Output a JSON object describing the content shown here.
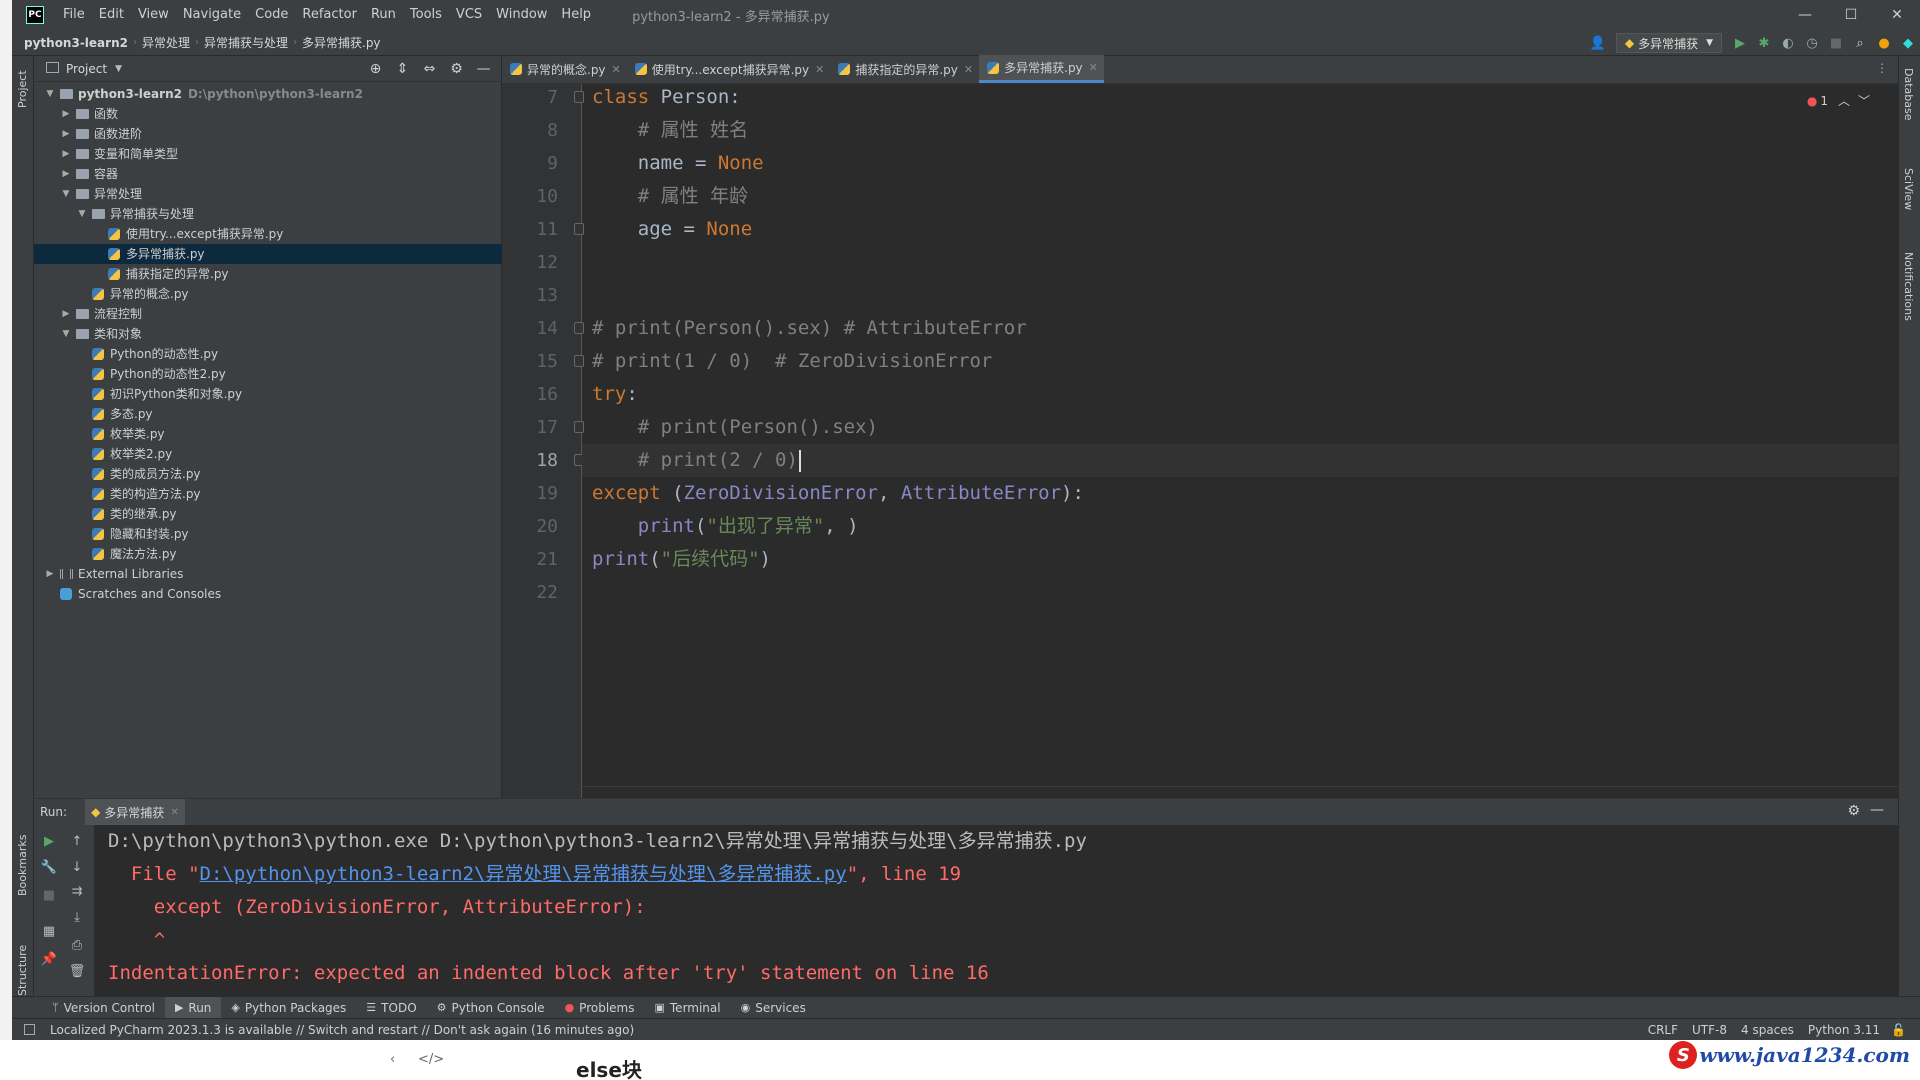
{
  "app": {
    "logo": "PC",
    "title": "python3-learn2 - 多异常捕获.py",
    "menu": [
      "File",
      "Edit",
      "View",
      "Navigate",
      "Code",
      "Refactor",
      "Run",
      "Tools",
      "VCS",
      "Window",
      "Help"
    ]
  },
  "navbar": {
    "crumbs": [
      "python3-learn2",
      "异常处理",
      "异常捕获与处理",
      "多异常捕获.py"
    ],
    "run_config": "多异常捕获"
  },
  "left_strip": {
    "project": "Project",
    "bookmarks": "Bookmarks",
    "structure": "Structure"
  },
  "right_strip": {
    "database": "Database",
    "sciview": "SciView",
    "notifications": "Notifications"
  },
  "project_panel": {
    "title": "Project",
    "tree": [
      {
        "label": "python3-learn2",
        "path": "D:\\python\\python3-learn2",
        "type": "folder",
        "depth": 0,
        "expanded": true,
        "bold": true
      },
      {
        "label": "函数",
        "type": "folder",
        "depth": 1,
        "expanded": false
      },
      {
        "label": "函数进阶",
        "type": "folder",
        "depth": 1,
        "expanded": false
      },
      {
        "label": "变量和简单类型",
        "type": "folder",
        "depth": 1,
        "expanded": false
      },
      {
        "label": "容器",
        "type": "folder",
        "depth": 1,
        "expanded": false
      },
      {
        "label": "异常处理",
        "type": "folder",
        "depth": 1,
        "expanded": true
      },
      {
        "label": "异常捕获与处理",
        "type": "folder",
        "depth": 2,
        "expanded": true
      },
      {
        "label": "使用try...except捕获异常.py",
        "type": "py",
        "depth": 3
      },
      {
        "label": "多异常捕获.py",
        "type": "py",
        "depth": 3,
        "selected": true
      },
      {
        "label": "捕获指定的异常.py",
        "type": "py",
        "depth": 3
      },
      {
        "label": "异常的概念.py",
        "type": "py",
        "depth": 2
      },
      {
        "label": "流程控制",
        "type": "folder",
        "depth": 1,
        "expanded": false
      },
      {
        "label": "类和对象",
        "type": "folder",
        "depth": 1,
        "expanded": true
      },
      {
        "label": "Python的动态性.py",
        "type": "py",
        "depth": 2
      },
      {
        "label": "Python的动态性2.py",
        "type": "py",
        "depth": 2
      },
      {
        "label": "初识Python类和对象.py",
        "type": "py",
        "depth": 2
      },
      {
        "label": "多态.py",
        "type": "py",
        "depth": 2
      },
      {
        "label": "枚举类.py",
        "type": "py",
        "depth": 2
      },
      {
        "label": "枚举类2.py",
        "type": "py",
        "depth": 2
      },
      {
        "label": "类的成员方法.py",
        "type": "py",
        "depth": 2
      },
      {
        "label": "类的构造方法.py",
        "type": "py",
        "depth": 2
      },
      {
        "label": "类的继承.py",
        "type": "py",
        "depth": 2
      },
      {
        "label": "隐藏和封装.py",
        "type": "py",
        "depth": 2
      },
      {
        "label": "魔法方法.py",
        "type": "py",
        "depth": 2
      },
      {
        "label": "External Libraries",
        "type": "lib",
        "depth": 0,
        "expanded": false
      },
      {
        "label": "Scratches and Consoles",
        "type": "scratch",
        "depth": 0
      }
    ]
  },
  "editor": {
    "tabs": [
      {
        "label": "异常的概念.py",
        "active": false
      },
      {
        "label": "使用try...except捕获异常.py",
        "active": false
      },
      {
        "label": "捕获指定的异常.py",
        "active": false
      },
      {
        "label": "多异常捕获.py",
        "active": true
      }
    ],
    "error_count": "1",
    "current_line": 18,
    "lines": [
      {
        "n": 7,
        "tokens": [
          [
            "kw",
            "class "
          ],
          [
            "plain",
            "Person:"
          ]
        ]
      },
      {
        "n": 8,
        "tokens": [
          [
            "cm",
            "    # 属性 姓名"
          ]
        ]
      },
      {
        "n": 9,
        "tokens": [
          [
            "plain",
            "    name = "
          ],
          [
            "kw",
            "None"
          ]
        ]
      },
      {
        "n": 10,
        "tokens": [
          [
            "cm",
            "    # 属性 年龄"
          ]
        ]
      },
      {
        "n": 11,
        "tokens": [
          [
            "plain",
            "    age = "
          ],
          [
            "kw",
            "None"
          ]
        ]
      },
      {
        "n": 12,
        "tokens": []
      },
      {
        "n": 13,
        "tokens": []
      },
      {
        "n": 14,
        "tokens": [
          [
            "cm",
            "# print(Person().sex) # AttributeError"
          ]
        ]
      },
      {
        "n": 15,
        "tokens": [
          [
            "cm",
            "# print(1 / 0)  # ZeroDivisionError"
          ]
        ]
      },
      {
        "n": 16,
        "tokens": [
          [
            "kw",
            "try"
          ],
          [
            "plain",
            ":"
          ]
        ]
      },
      {
        "n": 17,
        "tokens": [
          [
            "cm",
            "    # print(Person().sex)"
          ]
        ]
      },
      {
        "n": 18,
        "tokens": [
          [
            "cm",
            "    # print(2 / 0)"
          ]
        ]
      },
      {
        "n": 19,
        "tokens": [
          [
            "kw",
            "except "
          ],
          [
            "plain",
            "("
          ],
          [
            "builtin",
            "ZeroDivisionError"
          ],
          [
            "plain",
            ", "
          ],
          [
            "builtin",
            "AttributeError"
          ],
          [
            "plain",
            "):"
          ]
        ]
      },
      {
        "n": 20,
        "tokens": [
          [
            "builtin",
            "    print"
          ],
          [
            "plain",
            "("
          ],
          [
            "str",
            "\"出现了异常\""
          ],
          [
            "plain",
            ", )"
          ]
        ]
      },
      {
        "n": 21,
        "tokens": [
          [
            "builtin",
            "print"
          ],
          [
            "plain",
            "("
          ],
          [
            "str",
            "\"后续代码\""
          ],
          [
            "plain",
            ")"
          ]
        ]
      },
      {
        "n": 22,
        "tokens": []
      }
    ]
  },
  "run_panel": {
    "label": "Run:",
    "tab": "多异常捕获",
    "console": [
      {
        "parts": [
          [
            "plain",
            "D:\\python\\python3\\python.exe D:\\python\\python3-learn2\\异常处理\\异常捕获与处理\\多异常捕获.py"
          ]
        ]
      },
      {
        "parts": [
          [
            "err",
            "  File \""
          ],
          [
            "link",
            "D:\\python\\python3-learn2\\异常处理\\异常捕获与处理\\多异常捕获.py"
          ],
          [
            "err",
            "\", line 19"
          ]
        ]
      },
      {
        "parts": [
          [
            "err",
            "    except (ZeroDivisionError, AttributeError):"
          ]
        ]
      },
      {
        "parts": [
          [
            "err",
            "    ^"
          ]
        ]
      },
      {
        "parts": [
          [
            "err",
            "IndentationError: expected an indented block after 'try' statement on line 16"
          ]
        ]
      }
    ]
  },
  "bottom_tools": [
    {
      "label": "Version Control",
      "icon": "branch-icon",
      "glyph": "ᛘ"
    },
    {
      "label": "Run",
      "icon": "run-icon",
      "glyph": "▶",
      "active": true
    },
    {
      "label": "Python Packages",
      "icon": "packages-icon",
      "glyph": "◈"
    },
    {
      "label": "TODO",
      "icon": "todo-icon",
      "glyph": "☰"
    },
    {
      "label": "Python Console",
      "icon": "python-console-icon",
      "glyph": "⚙"
    },
    {
      "label": "Problems",
      "icon": "problems-icon",
      "glyph": "●"
    },
    {
      "label": "Terminal",
      "icon": "terminal-icon",
      "glyph": "▣"
    },
    {
      "label": "Services",
      "icon": "services-icon",
      "glyph": "◉"
    }
  ],
  "statusbar": {
    "message": "Localized PyCharm 2023.1.3 is available // Switch and restart // Don't ask again (16 minutes ago)",
    "line_sep": "CRLF",
    "encoding": "UTF-8",
    "indent": "4 spaces",
    "interpreter": "Python 3.11"
  },
  "below": {
    "title": "else块",
    "watermark": "www.java1234.com"
  },
  "colors": {
    "keyword": "#cc7832",
    "comment": "#808080",
    "string": "#6a8759",
    "builtin": "#8888c6",
    "error": "#ff6b68",
    "link": "#5394ec",
    "selection": "#0d293e"
  }
}
